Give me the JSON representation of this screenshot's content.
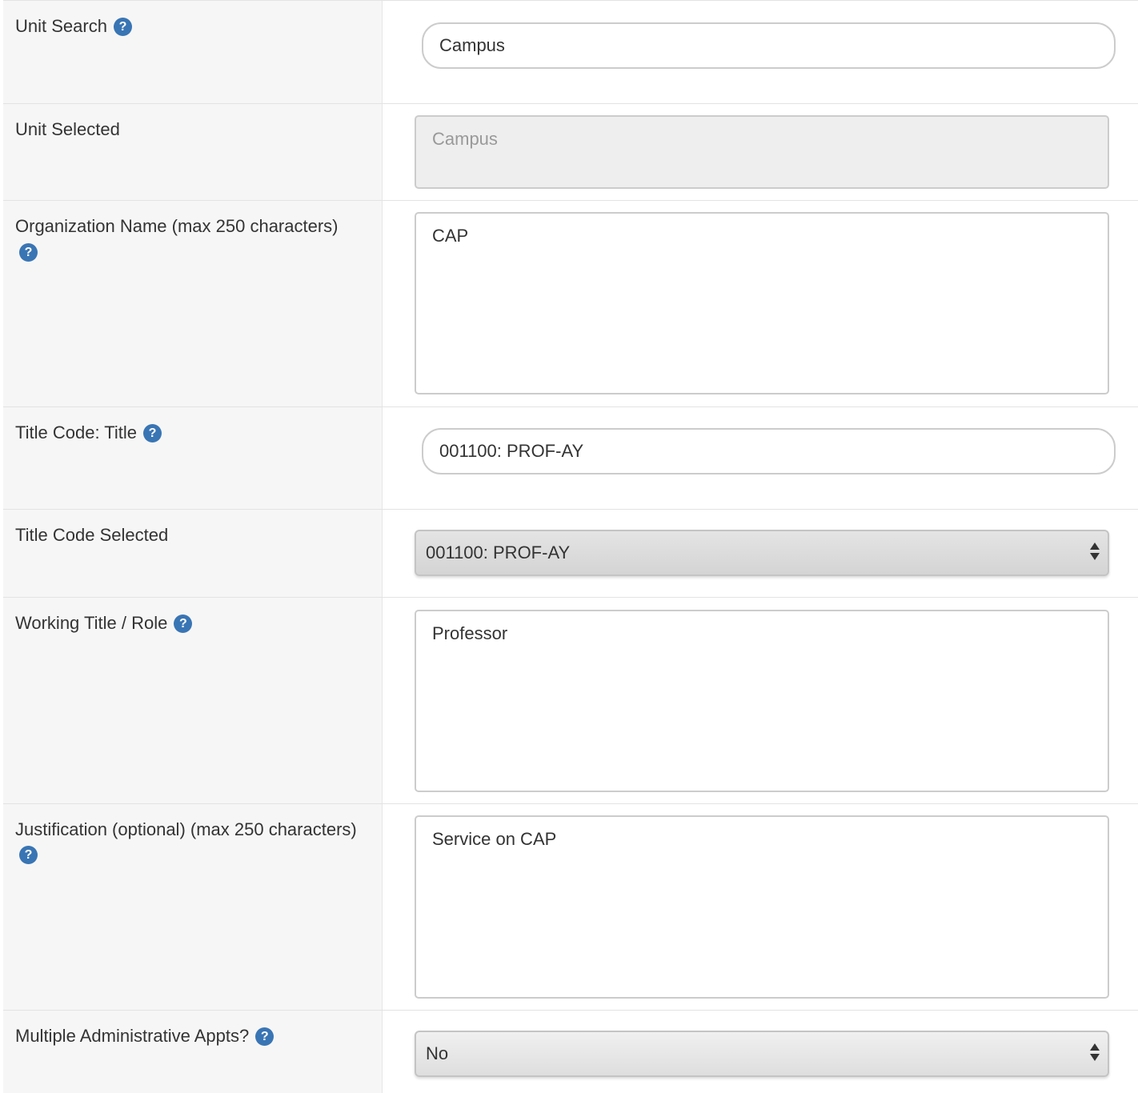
{
  "fields": {
    "unit_search": {
      "label": "Unit Search",
      "value": "Campus"
    },
    "unit_selected": {
      "label": "Unit Selected",
      "value": "Campus"
    },
    "organization_name": {
      "label": "Organization Name (max 250 characters)",
      "value": "CAP"
    },
    "title_code_title": {
      "label": "Title Code: Title",
      "value": "001100: PROF-AY"
    },
    "title_code_selected": {
      "label": "Title Code Selected",
      "value": "001100: PROF-AY"
    },
    "working_title_role": {
      "label": "Working Title / Role",
      "value": "Professor"
    },
    "justification": {
      "label": "Justification (optional) (max 250 characters)",
      "value": "Service on CAP"
    },
    "multiple_admin_appts": {
      "label": "Multiple Administrative Appts?",
      "value": "No"
    }
  },
  "help_icon": {
    "glyph": "?",
    "color": "#3975b4"
  }
}
